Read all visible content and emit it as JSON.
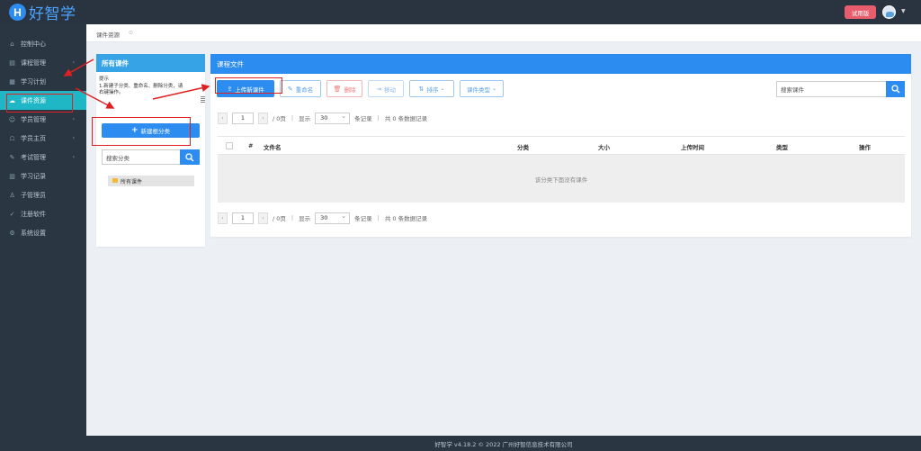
{
  "app": {
    "logo_letter": "H",
    "logo_text": "好智学",
    "trial_label": "试用版"
  },
  "sidebar": {
    "items": [
      {
        "label": "控制中心",
        "icon": "home-icon",
        "caret": false
      },
      {
        "label": "课程管理",
        "icon": "book-icon",
        "caret": true
      },
      {
        "label": "学习计划",
        "icon": "calendar-icon",
        "caret": false
      },
      {
        "label": "课件资源",
        "icon": "cloud-icon",
        "caret": false,
        "active": true
      },
      {
        "label": "学员管理",
        "icon": "users-icon",
        "caret": true
      },
      {
        "label": "学员主页",
        "icon": "user-home-icon",
        "caret": true
      },
      {
        "label": "考试管理",
        "icon": "exam-icon",
        "caret": true
      },
      {
        "label": "学习记录",
        "icon": "record-icon",
        "caret": false
      },
      {
        "label": "子管理员",
        "icon": "admin-icon",
        "caret": false
      },
      {
        "label": "注册软件",
        "icon": "check-circle-icon",
        "caret": false
      },
      {
        "label": "系统设置",
        "icon": "gear-icon",
        "caret": false
      }
    ]
  },
  "breadcrumb": {
    "label": "课件资源"
  },
  "left_panel": {
    "title": "所有课件",
    "tip_title": "提示",
    "tip_line1": "1.新建子分类、重命名、删除分类，请",
    "tip_line2": "右键操作。",
    "new_category_label": "新建根分类",
    "search_placeholder": "搜索分类",
    "tree_root_label": "所有课件"
  },
  "main_panel": {
    "title": "课程文件",
    "toolbar": {
      "upload_label": "上传新课件",
      "rename_label": "重命名",
      "delete_label": "删除",
      "move_label": "移动",
      "sort_label": "排序",
      "type_label": "课件类型"
    },
    "search_placeholder": "搜索课件",
    "pager": {
      "page_value": "1",
      "total_pages": "/ 0页",
      "show_label": "显示",
      "page_size": "30",
      "per_page_label": "条记录",
      "total_label": "共 0 条数据记录"
    },
    "table": {
      "columns": [
        "#",
        "文件名",
        "分类",
        "大小",
        "上传时间",
        "类型",
        "操作"
      ],
      "empty_text": "该分类下面没有课件"
    }
  },
  "footer": {
    "text": "好智学 v4.18.2 © 2022 广州好智信息技术有限公司"
  },
  "colors": {
    "sidebar_bg": "#2b3643",
    "active_item": "#1fb6c6",
    "primary": "#2d8cf0",
    "annotation_red": "#e02020",
    "trial_badge": "#e85d6c"
  }
}
